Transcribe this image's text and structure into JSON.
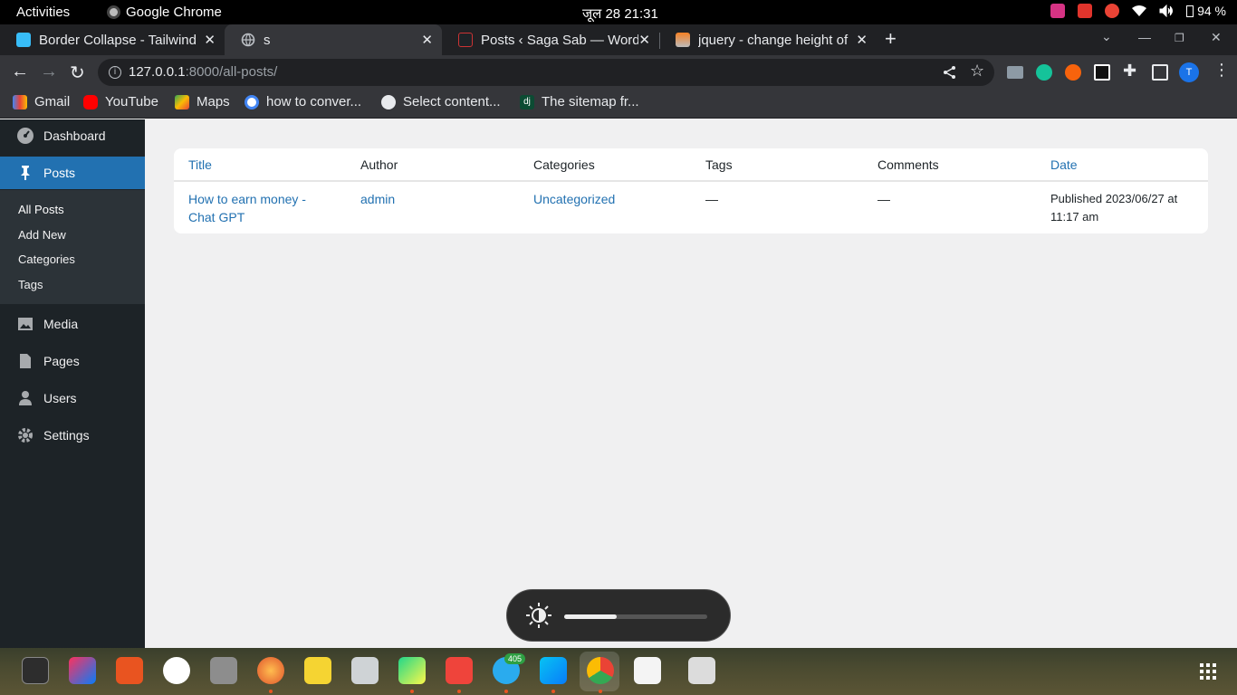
{
  "topbar": {
    "activities": "Activities",
    "app_name": "Google Chrome",
    "clock": "जूल 28  21:31",
    "battery": "94 %"
  },
  "tabs": [
    {
      "title": "Border Collapse - Tailwind",
      "icon": "tailwind-icon"
    },
    {
      "title": "s",
      "icon": "globe-icon"
    },
    {
      "title": "Posts ‹ Saga Sab — WordPress",
      "icon": "wordpress-icon"
    },
    {
      "title": "jquery - change height of",
      "icon": "stackoverflow-icon"
    }
  ],
  "omnibox": {
    "host": "127.0.0.1",
    "path": ":8000/all-posts/"
  },
  "bookmarks": [
    {
      "label": "Gmail",
      "icon": "gmail-icon"
    },
    {
      "label": "YouTube",
      "icon": "youtube-icon"
    },
    {
      "label": "Maps",
      "icon": "maps-icon"
    },
    {
      "label": "how to conver...",
      "icon": "google-icon"
    },
    {
      "label": "Select content...",
      "icon": "globe-icon"
    },
    {
      "label": "The sitemap fr...",
      "icon": "django-icon"
    }
  ],
  "sidebar": {
    "items": [
      {
        "label": "Dashboard",
        "icon": "dashboard-icon"
      },
      {
        "label": "Posts",
        "icon": "pin-icon",
        "current": true
      },
      {
        "label": "Media",
        "icon": "media-icon"
      },
      {
        "label": "Pages",
        "icon": "page-icon"
      },
      {
        "label": "Users",
        "icon": "user-icon"
      },
      {
        "label": "Settings",
        "icon": "gear-icon"
      }
    ],
    "sub": [
      "All Posts",
      "Add New",
      "Categories",
      "Tags"
    ]
  },
  "table": {
    "headers": [
      "Title",
      "Author",
      "Categories",
      "Tags",
      "Comments",
      "Date"
    ],
    "rows": [
      {
        "title_line1": "How to earn money -",
        "title_line2": "Chat GPT",
        "author": "admin",
        "categories": "Uncategorized",
        "tags": "—",
        "comments": "—",
        "date_line1": "Published 2023/06/27 at",
        "date_line2": "11:17 am"
      }
    ]
  },
  "osd": {
    "brightness_level": 0.37
  },
  "dock": {
    "telegram_badge": "405"
  },
  "colors": {
    "wp_admin_dark": "#1d2327",
    "wp_blue": "#2271b1",
    "chrome_dark": "#35363a"
  }
}
